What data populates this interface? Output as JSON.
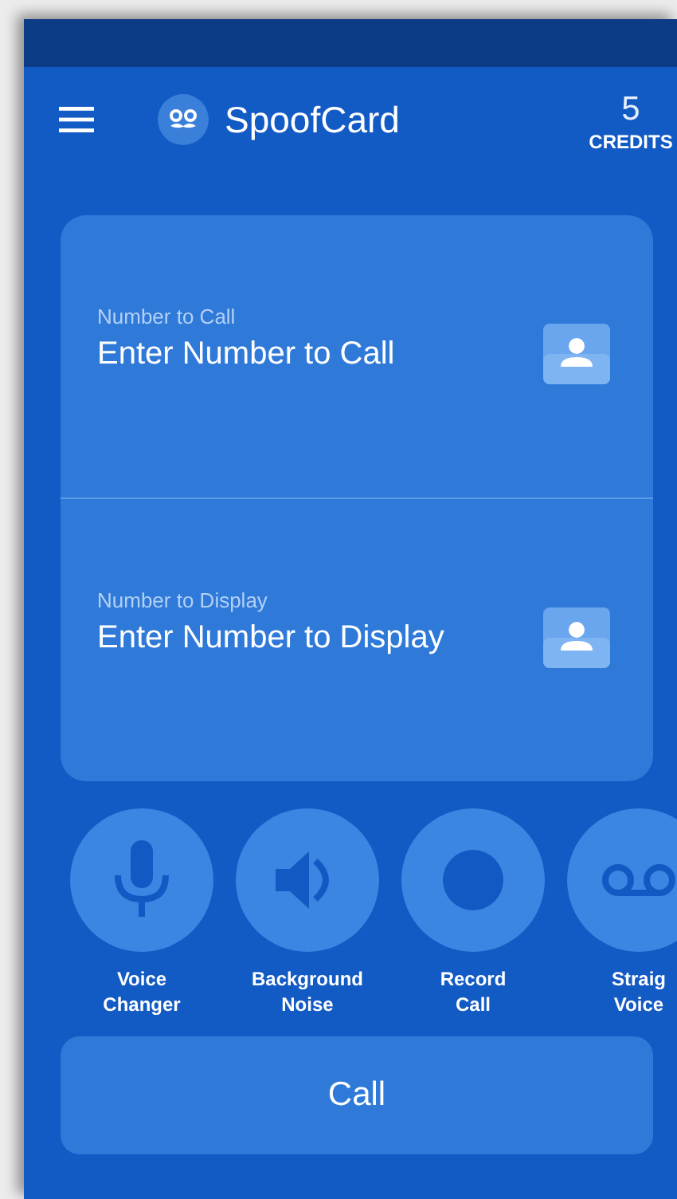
{
  "app_bar": {
    "title": "SpoofCard",
    "credits_count": "5",
    "credits_label": "CREDITS"
  },
  "fields": [
    {
      "label": "Number to Call",
      "placeholder": "Enter Number to Call"
    },
    {
      "label": "Number to Display",
      "placeholder": "Enter Number to Display"
    }
  ],
  "features": [
    {
      "kind": "mic",
      "lines": [
        "Voice",
        "Changer"
      ]
    },
    {
      "kind": "speaker",
      "lines": [
        "Background",
        "Noise"
      ]
    },
    {
      "kind": "record",
      "lines": [
        "Record",
        "Call"
      ]
    },
    {
      "kind": "voicemail",
      "lines": [
        "Straig",
        "Voice"
      ]
    }
  ],
  "call_button": "Call"
}
